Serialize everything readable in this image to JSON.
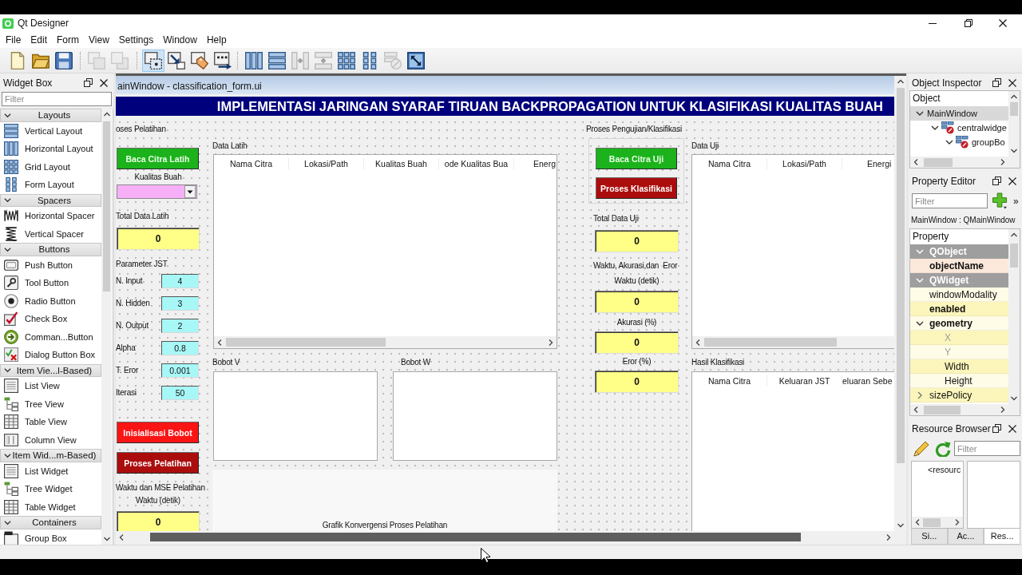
{
  "window": {
    "title": "Qt Designer"
  },
  "menu": [
    "File",
    "Edit",
    "Form",
    "View",
    "Settings",
    "Window",
    "Help"
  ],
  "toolbar": {
    "groups": [
      {
        "items": [
          {
            "kind": "new",
            "disabled": false
          },
          {
            "kind": "open",
            "disabled": false
          },
          {
            "kind": "save",
            "disabled": false
          }
        ]
      },
      {
        "items": [
          {
            "kind": "send-back",
            "disabled": true
          },
          {
            "kind": "bring-front",
            "disabled": true
          }
        ]
      },
      {
        "items": [
          {
            "kind": "edit-widgets",
            "selected": true,
            "disabled": false
          },
          {
            "kind": "signals-slots",
            "selected": false,
            "disabled": false
          },
          {
            "kind": "buddies",
            "selected": false,
            "disabled": false
          },
          {
            "kind": "tab-order",
            "selected": false,
            "disabled": false
          }
        ]
      },
      {
        "items": [
          {
            "kind": "layout-horizontal",
            "disabled": false
          },
          {
            "kind": "layout-vertical",
            "disabled": false
          },
          {
            "kind": "split-horizontal",
            "disabled": true
          },
          {
            "kind": "split-vertical",
            "disabled": true
          },
          {
            "kind": "layout-grid",
            "disabled": false
          },
          {
            "kind": "layout-form",
            "disabled": false
          },
          {
            "kind": "break-layout",
            "disabled": true
          },
          {
            "kind": "adjust-size",
            "disabled": false
          }
        ]
      }
    ]
  },
  "widget_box": {
    "title": "Widget Box",
    "filter": {
      "placeholder": "Filter"
    },
    "categories": [
      {
        "label": "Layouts",
        "expanded": true,
        "items": [
          {
            "label": "Vertical Layout",
            "kind": "vbox"
          },
          {
            "label": "Horizontal Layout",
            "kind": "hbox"
          },
          {
            "label": "Grid Layout",
            "kind": "grid"
          },
          {
            "label": "Form Layout",
            "kind": "form"
          }
        ]
      },
      {
        "label": "Spacers",
        "expanded": true,
        "items": [
          {
            "label": "Horizontal Spacer",
            "kind": "hspacer"
          },
          {
            "label": "Vertical Spacer",
            "kind": "vspacer"
          }
        ]
      },
      {
        "label": "Buttons",
        "expanded": true,
        "items": [
          {
            "label": "Push Button",
            "kind": "push"
          },
          {
            "label": "Tool Button",
            "kind": "tool"
          },
          {
            "label": "Radio Button",
            "kind": "radio"
          },
          {
            "label": "Check Box",
            "kind": "check"
          },
          {
            "label": "Comman...Button",
            "kind": "command"
          },
          {
            "label": "Dialog Button Box",
            "kind": "dialog"
          }
        ]
      },
      {
        "label": "Item Vie...l-Based)",
        "expanded": true,
        "items": [
          {
            "label": "List View",
            "kind": "list"
          },
          {
            "label": "Tree View",
            "kind": "tree"
          },
          {
            "label": "Table View",
            "kind": "table"
          },
          {
            "label": "Column View",
            "kind": "column"
          }
        ]
      },
      {
        "label": "Item Wid...m-Based)",
        "expanded": true,
        "items": [
          {
            "label": "List Widget",
            "kind": "list"
          },
          {
            "label": "Tree Widget",
            "kind": "tree"
          },
          {
            "label": "Table Widget",
            "kind": "table"
          }
        ]
      },
      {
        "label": "Containers",
        "expanded": true,
        "items": [
          {
            "label": "Group Box",
            "kind": "group"
          }
        ]
      }
    ]
  },
  "form_window": {
    "title": "ainWindow - classification_form.ui",
    "banner": "IMPLEMENTASI JARINGAN SYARAF TIRUAN BACKPROPAGATION UNTUK KLASIFIKASI KUALITAS BUAH",
    "training": {
      "title": "oses Pelatihan",
      "read_button": "Baca Citra Latih",
      "quality_label": "Kualitas Buah",
      "total": {
        "label": "Total Data Latih",
        "value": "0"
      },
      "parameters": {
        "title": "Parameter JST",
        "rows": [
          {
            "label": "N. Input",
            "value": "4"
          },
          {
            "label": "N. Hidden",
            "value": "3"
          },
          {
            "label": "N. Output",
            "value": "2"
          },
          {
            "label": "Alpha",
            "value": "0.8"
          },
          {
            "label": "T. Eror",
            "value": "0.001"
          },
          {
            "label": "Iterasi",
            "value": "50"
          }
        ]
      },
      "init_button": "Inisialisasi Bobot",
      "train_button": "Proses Pelatihan",
      "results": {
        "title": "Waktu dan MSE Pelatihan",
        "fields": [
          {
            "label": "Waktu (detik)",
            "value": "0"
          }
        ]
      },
      "data_table": {
        "title": "Data Latih",
        "columns": [
          "Nama Citra",
          "Lokasi/Path",
          "Kualitas Buah",
          "ode Kualitas Bua",
          "Energ"
        ]
      },
      "weights": [
        {
          "title": "Bobot V"
        },
        {
          "title": "Bobot W"
        }
      ],
      "chart_label": "Grafik Konvergensi Proses Pelatihan"
    },
    "testing": {
      "title": "Proses Pengujian/Klasifikasi",
      "read_button": "Baca Citra Uji",
      "classify_button": "Proses Klasifikasi",
      "total": {
        "label": "Total Data Uji",
        "value": "0"
      },
      "results": {
        "title": "Waktu, Akurasi,dan  Eror",
        "fields": [
          {
            "label": "Waktu (detik)",
            "value": "0"
          },
          {
            "label": "Akurasi (%)",
            "value": "0"
          },
          {
            "label": "Eror (%)",
            "value": "0"
          }
        ]
      },
      "data_table": {
        "title": "Data Uji",
        "columns": [
          "Nama Citra",
          "Lokasi/Path",
          "Energi"
        ]
      },
      "result_table": {
        "title": "Hasil Klasifikasi",
        "columns": [
          "Nama Citra",
          "Keluaran JST",
          "eluaran Sebe"
        ]
      }
    }
  },
  "object_inspector": {
    "title": "Object Inspector",
    "header": "Object",
    "tree": [
      {
        "label": "MainWindow",
        "selected": true,
        "expanded": true,
        "children": [
          {
            "label": "centralwidge",
            "kind": "widget",
            "selected": false,
            "expanded": true,
            "children": [
              {
                "label": "groupBo",
                "kind": "widget",
                "selected": false,
                "expanded": true
              }
            ]
          }
        ]
      }
    ]
  },
  "property_editor": {
    "title": "Property Editor",
    "filter": {
      "placeholder": "Filter"
    },
    "more": "»",
    "object": "MainWindow : QMainWindow",
    "header": "Property",
    "groups": [
      {
        "label": "QObject",
        "expanded": true,
        "color": "#fce8da",
        "properties": [
          {
            "label": "objectName",
            "bold": true
          }
        ]
      },
      {
        "label": "QWidget",
        "expanded": true,
        "color": "#fefce6",
        "properties": [
          {
            "label": "windowModality",
            "bold": false
          },
          {
            "label": "enabled",
            "bold": true
          },
          {
            "label": "geometry",
            "bold": true,
            "expanded": true,
            "children": [
              {
                "label": "X",
                "disabled": true
              },
              {
                "label": "Y",
                "disabled": true
              },
              {
                "label": "Width",
                "disabled": false
              },
              {
                "label": "Height",
                "disabled": false
              }
            ]
          },
          {
            "label": "sizePolicy",
            "bold": false,
            "expanded": false
          }
        ]
      }
    ]
  },
  "resource_browser": {
    "title": "Resource Browser",
    "filter": {
      "placeholder": "Filter"
    },
    "tree": [
      {
        "label": "<resourc"
      }
    ]
  },
  "dock_tabs": [
    {
      "label": "Si...",
      "selected": false
    },
    {
      "label": "Ac...",
      "selected": false
    },
    {
      "label": "Res...",
      "selected": true
    }
  ]
}
